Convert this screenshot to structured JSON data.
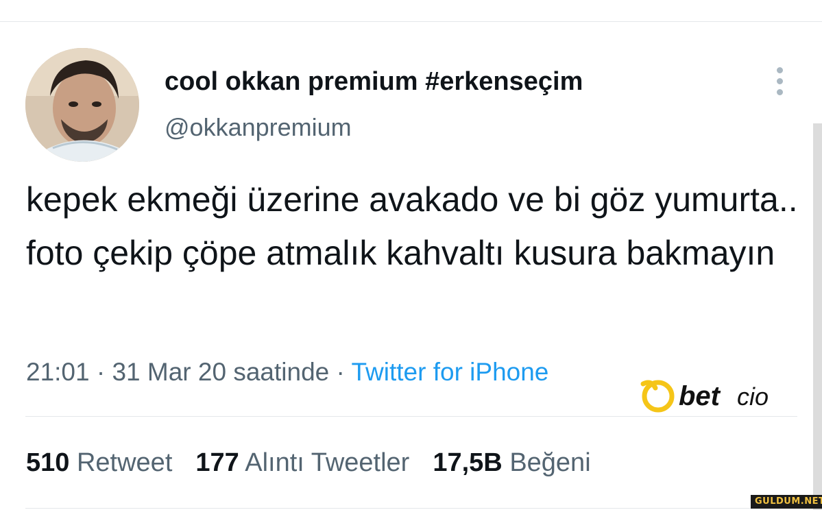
{
  "tweet": {
    "author": {
      "display_name": "cool okkan premium #erkenseçim",
      "handle": "@okkanpremium"
    },
    "text": "kepek ekmeği üzerine avakado ve bi göz yumurta.. foto çekip çöpe atmalık kahvaltı kusura bakmayın",
    "meta": {
      "time_date": "21:01 · 31 Mar 20 saatinde ·",
      "source": "Twitter for iPhone"
    },
    "stats": {
      "retweets": {
        "count": "510",
        "label": "Retweet"
      },
      "quotes": {
        "count": "177",
        "label": "Alıntı Tweetler"
      },
      "likes": {
        "count": "17,5B",
        "label": "Beğeni"
      }
    }
  },
  "overlays": {
    "betcio_logo": "betcio",
    "watermark": "GULDUM.NET"
  },
  "colors": {
    "text_primary": "#0f1419",
    "text_secondary": "#536471",
    "link_blue": "#1d9bf0",
    "logo_yellow": "#f5c518",
    "divider": "#e4e7ea"
  },
  "icons": {
    "more": "more-vertical-icon",
    "avatar": "profile-photo"
  }
}
